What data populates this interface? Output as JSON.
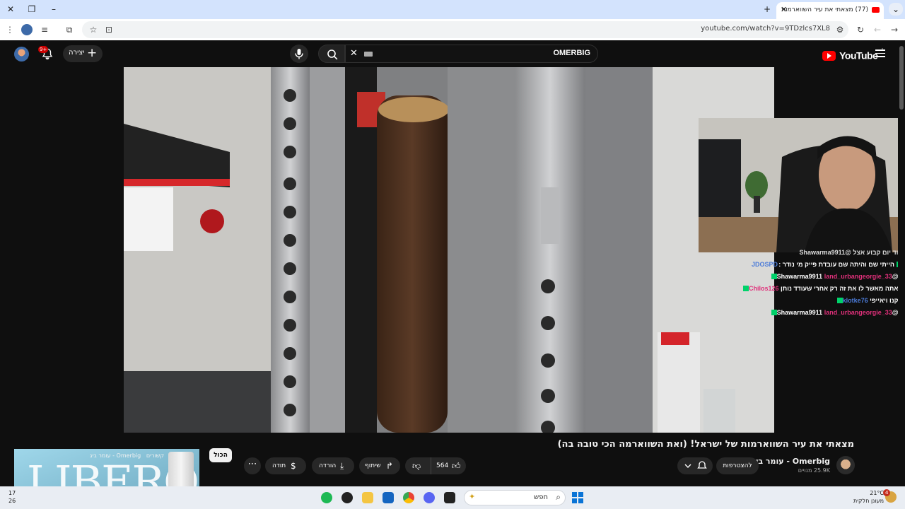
{
  "browser": {
    "tab_title": "(77) מצאתי את עיר השווארמות",
    "url": "youtube.com/watch?v=9TDzlcs7XL8"
  },
  "header": {
    "search_query": "OMERBIG",
    "logo_text": "YouTube",
    "logo_superscript": "IL",
    "create_label": "יצירה",
    "notification_count": "9+"
  },
  "chat": {
    "lines": [
      {
        "user": "",
        "text": "עוד יום קבוע אצל @Shawarma9911"
      },
      {
        "user": "",
        "text": "הייתי שם והיתה שם עובדת פייק מי נודר :"
      },
      {
        "user": "JDOSPD",
        "text": ""
      },
      {
        "user": "land_urbangeorgie_33",
        "text": ": @Shawarma9911"
      },
      {
        "user": "Chilos126",
        "text": ": אתה מאשר לו את זה רק אחרי שעודד נותן"
      },
      {
        "user": "klotke76",
        "text": ": קנו ויאייפי"
      },
      {
        "user": "land_urbangeorgie_33",
        "text": ": @Shawarma9911"
      }
    ]
  },
  "video": {
    "title": "מצאתי את עיר השווארמות של ישראל! (ואת השווארמה הכי טובה בה)",
    "channel_name": "Omerbig - עומר ביג",
    "subscribers": "25.9K מנויים",
    "subscribe_label": "להצטרפות",
    "likes": "564",
    "share_label": "שיתוף",
    "download_label": "הורדה",
    "thanks_label": "תודה",
    "all_chip": "הכול"
  },
  "ad": {
    "brand": "LIBERO",
    "caption": "Omerbig - עומר ביג",
    "related_label": "קשורים"
  },
  "taskbar": {
    "search_label": "חפש",
    "weather_temp": "21°C",
    "weather_desc": "מעונן חלקית",
    "clock_line1": "17",
    "clock_line2": "26",
    "notif_badge": "4"
  }
}
